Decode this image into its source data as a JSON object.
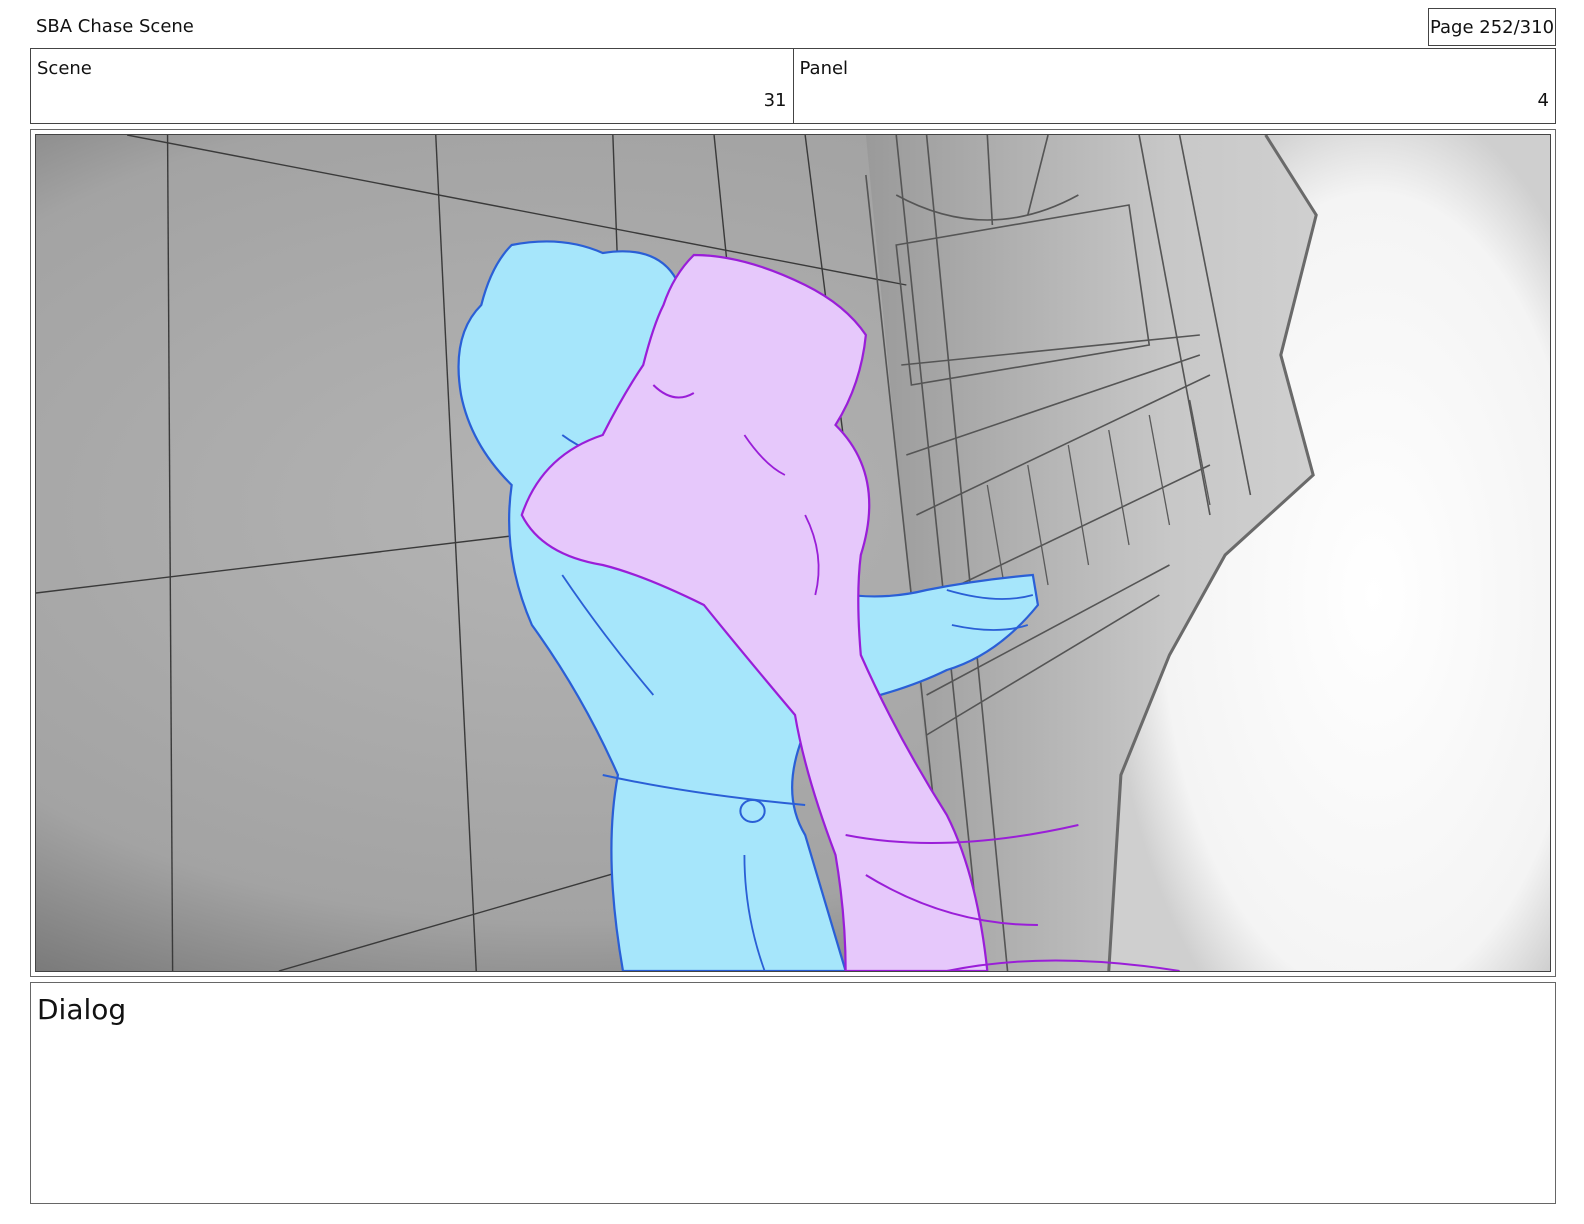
{
  "header": {
    "title": "SBA Chase Scene",
    "page": "Page 252/310"
  },
  "info": {
    "scene_label": "Scene",
    "scene_value": "31",
    "panel_label": "Panel",
    "panel_value": "4"
  },
  "dialog": {
    "label": "Dialog"
  },
  "colors": {
    "figure_left_fill": "#a6e6fb",
    "figure_left_line": "#2a5fd6",
    "figure_right_fill": "#e6c8fb",
    "figure_right_line": "#9a1ed8"
  }
}
